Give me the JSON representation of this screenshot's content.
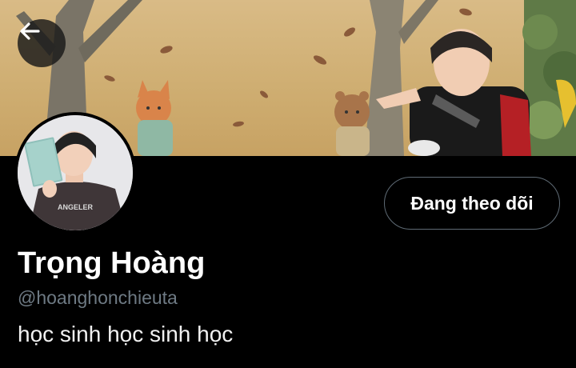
{
  "header": {
    "back_icon": "arrow-left-icon",
    "banner_image": "mural-wall-photo"
  },
  "profile": {
    "avatar_image": "profile-photo",
    "display_name": "Trọng Hoàng",
    "handle": "@hoanghonchieuta",
    "bio": "học sinh học sinh học",
    "follow_button_label": "Đang theo dõi"
  },
  "colors": {
    "background": "#000000",
    "handle_gray": "#6e7a84",
    "button_border": "#5f6b75"
  }
}
